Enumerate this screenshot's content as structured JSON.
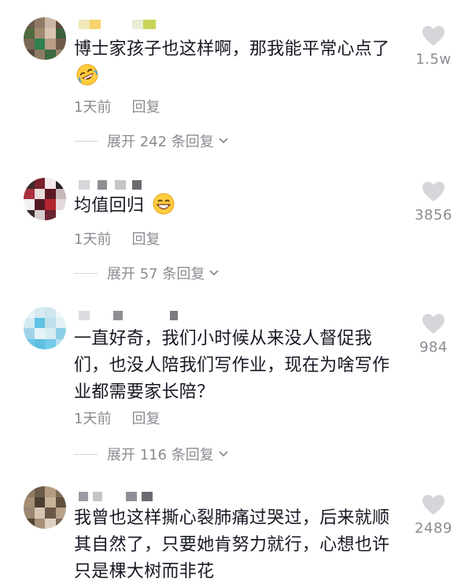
{
  "comments": [
    {
      "text": "博士家孩子也这样啊，那我能平常心点了",
      "emoji": "rofl-emoji",
      "time": "1天前",
      "reply": "回复",
      "expand": "展开 242 条回复",
      "likes": "1.5w"
    },
    {
      "text": "均值回归",
      "emoji": "grin-emoji",
      "time": "1天前",
      "reply": "回复",
      "expand": "展开 57 条回复",
      "likes": "3856"
    },
    {
      "text": "一直好奇，我们小时候从来没人督促我们，也没人陪我们写作业，现在为啥写作业都需要家长陪？",
      "time": "1天前",
      "reply": "回复",
      "expand": "展开 116 条回复",
      "likes": "984"
    },
    {
      "text": "我曾也这样撕心裂肺痛过哭过，后来就顺其自然了，只要她肯努力就行，心想也许只是棵大树而非花",
      "likes": "2489"
    }
  ],
  "icons": {
    "like": "heart-icon",
    "expand": "chevron-down-icon"
  },
  "colors": {
    "text": "#161823",
    "secondary": "#8a8b91",
    "heart": "#d5d6d9"
  }
}
